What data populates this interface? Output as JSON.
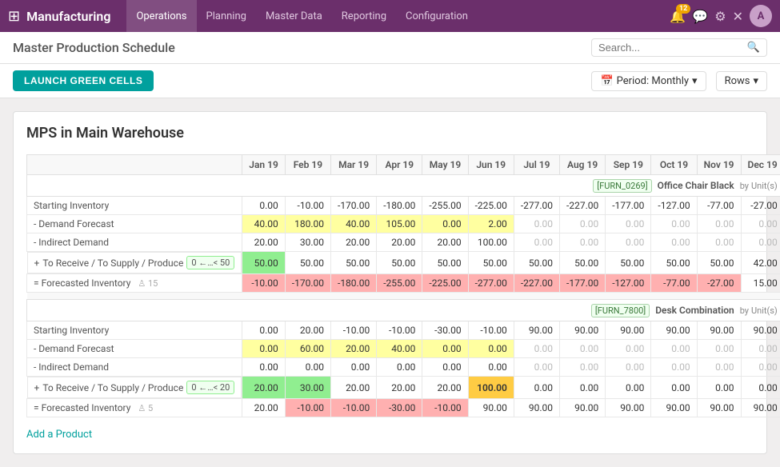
{
  "app": {
    "grid_icon": "⊞",
    "title": "Manufacturing"
  },
  "navbar": {
    "menu_items": [
      {
        "label": "Operations",
        "active": true
      },
      {
        "label": "Planning"
      },
      {
        "label": "Master Data"
      },
      {
        "label": "Reporting"
      },
      {
        "label": "Configuration"
      }
    ],
    "notification_count": "12"
  },
  "subheader": {
    "page_title": "Master Production Schedule",
    "search_placeholder": "Search..."
  },
  "toolbar": {
    "launch_btn": "LAUNCH GREEN CELLS",
    "period_label": "Period: Monthly",
    "rows_label": "Rows"
  },
  "mps": {
    "title": "MPS in Main Warehouse",
    "months": [
      "Jan 19",
      "Feb 19",
      "Mar 19",
      "Apr 19",
      "May 19",
      "Jun 19",
      "Jul 19",
      "Aug 19",
      "Sep 19",
      "Oct 19",
      "Nov 19",
      "Dec 19"
    ],
    "product1": {
      "ref": "[FURN_0269]",
      "name": "Office Chair Black",
      "by": "by",
      "unit": "Unit(s)",
      "range": "0 ←…< 50",
      "rows": {
        "starting_inventory": {
          "label": "Starting Inventory",
          "values": [
            "0.00",
            "-10.00",
            "-170.00",
            "-180.00",
            "-255.00",
            "-225.00",
            "-277.00",
            "-227.00",
            "-177.00",
            "-127.00",
            "-77.00",
            "-27.00"
          ]
        },
        "demand_forecast": {
          "label": "Demand Forecast",
          "values": [
            "40.00",
            "180.00",
            "40.00",
            "105.00",
            "0.00",
            "2.00",
            "0.00",
            "0.00",
            "0.00",
            "0.00",
            "0.00",
            "0.00"
          ]
        },
        "indirect_demand": {
          "label": "Indirect Demand",
          "values": [
            "20.00",
            "30.00",
            "20.00",
            "20.00",
            "20.00",
            "100.00",
            "0.00",
            "0.00",
            "0.00",
            "0.00",
            "0.00",
            "0.00"
          ]
        },
        "to_receive": {
          "label": "To Receive / To Supply / Produce",
          "values": [
            "50.00",
            "50.00",
            "50.00",
            "50.00",
            "50.00",
            "50.00",
            "50.00",
            "50.00",
            "50.00",
            "50.00",
            "50.00",
            "42.00"
          ]
        },
        "forecasted_inventory": {
          "label": "Forecasted Inventory",
          "icon": "♙",
          "icon_num": "15",
          "values": [
            "-10.00",
            "-170.00",
            "-180.00",
            "-255.00",
            "-225.00",
            "-277.00",
            "-227.00",
            "-177.00",
            "-127.00",
            "-77.00",
            "-27.00",
            "15.00"
          ]
        }
      }
    },
    "product2": {
      "ref": "[FURN_7800]",
      "name": "Desk Combination",
      "by": "by",
      "unit": "Unit(s)",
      "range": "0 ←…< 20",
      "rows": {
        "starting_inventory": {
          "label": "Starting Inventory",
          "values": [
            "0.00",
            "20.00",
            "-10.00",
            "-10.00",
            "-30.00",
            "-10.00",
            "90.00",
            "90.00",
            "90.00",
            "90.00",
            "90.00",
            "90.00"
          ]
        },
        "demand_forecast": {
          "label": "Demand Forecast",
          "values": [
            "0.00",
            "60.00",
            "20.00",
            "40.00",
            "0.00",
            "0.00",
            "0.00",
            "0.00",
            "0.00",
            "0.00",
            "0.00",
            "0.00"
          ]
        },
        "indirect_demand": {
          "label": "Indirect Demand",
          "values": [
            "0.00",
            "0.00",
            "0.00",
            "0.00",
            "0.00",
            "0.00",
            "0.00",
            "0.00",
            "0.00",
            "0.00",
            "0.00",
            "0.00"
          ]
        },
        "to_receive": {
          "label": "To Receive / To Supply / Produce",
          "values": [
            "20.00",
            "30.00",
            "20.00",
            "20.00",
            "20.00",
            "100.00",
            "0.00",
            "0.00",
            "0.00",
            "0.00",
            "0.00",
            "0.00"
          ]
        },
        "forecasted_inventory": {
          "label": "Forecasted Inventory",
          "icon": "♙",
          "icon_num": "5",
          "values": [
            "20.00",
            "-10.00",
            "-10.00",
            "-30.00",
            "-10.00",
            "90.00",
            "90.00",
            "90.00",
            "90.00",
            "90.00",
            "90.00",
            "90.00"
          ]
        }
      }
    },
    "add_product": "Add a Product"
  }
}
